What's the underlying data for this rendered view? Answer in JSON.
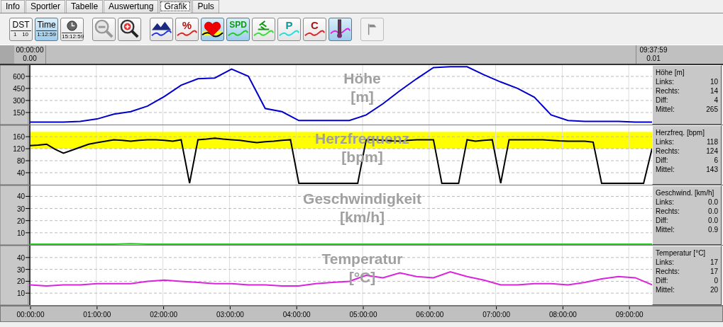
{
  "tabs": [
    {
      "label": "Info",
      "selected": false
    },
    {
      "label": "Sportler",
      "selected": false
    },
    {
      "label": "Tabelle",
      "selected": false
    },
    {
      "label": "Auswertung",
      "selected": false
    },
    {
      "label": "Grafik",
      "selected": true
    },
    {
      "label": "Puls",
      "selected": false
    }
  ],
  "toolbar": {
    "groups": [
      [
        {
          "kind": "dst",
          "label": "DST",
          "scale": [
            "1",
            "10"
          ],
          "selected": false
        },
        {
          "kind": "time",
          "label": "Time",
          "reading": "1:12:59",
          "selected": true
        },
        {
          "kind": "clock",
          "reading": "15:12:59",
          "selected": false
        }
      ],
      [
        {
          "kind": "zoom_out"
        },
        {
          "kind": "zoom_in"
        }
      ],
      [
        {
          "kind": "altitude",
          "selected": false
        },
        {
          "kind": "percent",
          "label": "%",
          "selected": false
        },
        {
          "kind": "heart",
          "selected": true
        },
        {
          "kind": "speed",
          "label": "SPD",
          "selected": true
        },
        {
          "kind": "cadence",
          "selected": false
        },
        {
          "kind": "power",
          "label": "P",
          "selected": false
        },
        {
          "kind": "calories",
          "label": "C",
          "selected": false
        },
        {
          "kind": "temperature",
          "selected": true
        }
      ],
      [
        {
          "kind": "flag",
          "disabled": true
        }
      ]
    ]
  },
  "ruler": {
    "left": {
      "time": "00:00:00",
      "value": "0.00"
    },
    "right": {
      "time": "09:37:59",
      "value": "0.01"
    }
  },
  "panels": [
    {
      "chart_data": {
        "type": "line",
        "title": "Höhe [m]",
        "categories": [
          null,
          null,
          null,
          null,
          null,
          null,
          null,
          null,
          null,
          null,
          null,
          null,
          null,
          null,
          null,
          null,
          null,
          null,
          null,
          null,
          null,
          null,
          null,
          null,
          null,
          null,
          null,
          null,
          null,
          null,
          null,
          null,
          null,
          null,
          null,
          null,
          null,
          null
        ],
        "ylim": [
          0,
          740
        ],
        "yticks": [
          150,
          300,
          450,
          600
        ],
        "grid": true,
        "series": [
          {
            "color": "#0000cc",
            "values": [
              30,
              30,
              30,
              40,
              70,
              130,
              160,
              230,
              350,
              490,
              570,
              580,
              690,
              600,
              200,
              160,
              50,
              50,
              50,
              50,
              120,
              260,
              420,
              570,
              710,
              720,
              720,
              620,
              530,
              450,
              340,
              120,
              50,
              40,
              40,
              40,
              30,
              30
            ]
          }
        ]
      },
      "info": {
        "heading": "Höhe [m]",
        "rows": [
          {
            "label": "Links:",
            "value": "10"
          },
          {
            "label": "Rechts:",
            "value": "14"
          },
          {
            "label": "Diff:",
            "value": "4"
          },
          {
            "label": "Mittel:",
            "value": "265"
          }
        ]
      }
    },
    {
      "chart_data": {
        "type": "line",
        "title": "Herzfrequenz [bpm]",
        "categories": [
          null,
          null,
          null,
          null,
          null,
          null,
          null,
          null,
          null,
          null,
          null,
          null,
          null,
          null,
          null,
          null,
          null,
          null,
          null,
          null,
          null,
          null,
          null,
          null,
          null,
          null,
          null,
          null,
          null,
          null,
          null,
          null,
          null,
          null,
          null,
          null,
          null,
          null,
          null,
          null,
          null,
          null,
          null,
          null,
          null,
          null,
          null,
          null,
          null,
          null,
          null,
          null,
          null,
          null,
          null,
          null,
          null,
          null,
          null,
          null,
          null,
          null,
          null,
          null,
          null,
          null,
          null,
          null,
          null,
          null,
          null,
          null,
          null,
          null,
          null
        ],
        "ylim": [
          0,
          198
        ],
        "yticks": [
          40,
          80,
          120,
          160
        ],
        "series": [
          {
            "color": "#000000",
            "values": [
              130,
              132,
              135,
              118,
              105,
              115,
              125,
              135,
              140,
              145,
              150,
              148,
              145,
              148,
              150,
              150,
              148,
              145,
              150,
              5,
              150,
              152,
              155,
              152,
              150,
              148,
              144,
              140,
              143,
              145,
              148,
              150,
              5,
              5,
              5,
              5,
              5,
              5,
              5,
              5,
              150,
              150,
              148,
              146,
              145,
              148,
              150,
              150,
              150,
              5,
              5,
              5,
              150,
              145,
              148,
              150,
              5,
              150,
              150,
              150,
              150,
              150,
              148,
              146,
              145,
              145,
              145,
              142,
              5,
              5,
              5,
              5,
              5,
              5,
              120
            ]
          }
        ],
        "grid": true,
        "bands": [
          {
            "axis": "y",
            "from": 120,
            "to": 176
          }
        ]
      },
      "info": {
        "heading": "Herzfreq. [bpm]",
        "rows": [
          {
            "label": "Links:",
            "value": "118"
          },
          {
            "label": "Rechts:",
            "value": "124"
          },
          {
            "label": "Diff:",
            "value": "6"
          },
          {
            "label": "Mittel:",
            "value": "143"
          }
        ]
      }
    },
    {
      "chart_data": {
        "type": "line",
        "title": "Geschwindigkeit [km/h]",
        "categories": [
          null,
          null,
          null,
          null,
          null,
          null,
          null,
          null,
          null,
          null,
          null,
          null,
          null,
          null,
          null,
          null,
          null,
          null,
          null,
          null,
          null,
          null,
          null,
          null,
          null,
          null,
          null,
          null,
          null,
          null,
          null,
          null,
          null,
          null,
          null,
          null,
          null,
          null
        ],
        "ylim": [
          0,
          49
        ],
        "yticks": [
          10,
          20,
          30,
          40
        ],
        "grid": true,
        "series": [
          {
            "color": "#22cc22",
            "values": [
              0,
              0,
              0,
              0,
              0,
              0,
              1,
              0,
              0,
              0,
              0,
              0,
              0,
              0,
              0,
              0,
              0,
              0,
              0,
              0,
              0,
              0,
              0,
              0,
              0,
              0,
              0,
              0,
              0,
              0,
              0,
              0,
              0,
              0,
              0,
              0,
              0,
              0
            ]
          }
        ]
      },
      "info": {
        "heading": "Geschwind. [km/h]",
        "rows": [
          {
            "label": "Links:",
            "value": "0.0"
          },
          {
            "label": "Rechts:",
            "value": "0.0"
          },
          {
            "label": "Diff:",
            "value": "0.0"
          },
          {
            "label": "Mittel:",
            "value": "0.9"
          }
        ]
      }
    },
    {
      "chart_data": {
        "type": "line",
        "title": "Temperatur [°C]",
        "categories": [
          null,
          null,
          null,
          null,
          null,
          null,
          null,
          null,
          null,
          null,
          null,
          null,
          null,
          null,
          null,
          null,
          null,
          null,
          null,
          null,
          null,
          null,
          null,
          null,
          null,
          null,
          null,
          null,
          null,
          null,
          null,
          null,
          null,
          null,
          null,
          null,
          null,
          null
        ],
        "ylim": [
          0,
          50
        ],
        "yticks": [
          10,
          20,
          30,
          40
        ],
        "grid": true,
        "series": [
          {
            "color": "#dd22dd",
            "values": [
              17,
              16,
              17,
              17,
              18,
              18,
              18,
              20,
              21,
              20,
              19,
              18,
              18,
              17,
              17,
              16,
              16,
              18,
              19,
              20,
              25,
              23,
              27,
              24,
              23,
              28,
              24,
              21,
              17,
              17,
              18,
              18,
              17,
              19,
              22,
              24,
              23,
              17
            ]
          }
        ]
      },
      "info": {
        "heading": "Temperatur [°C]",
        "rows": [
          {
            "label": "Links:",
            "value": "17"
          },
          {
            "label": "Rechts:",
            "value": "17"
          },
          {
            "label": "Diff:",
            "value": "0"
          },
          {
            "label": "Mittel:",
            "value": "20"
          }
        ]
      }
    }
  ],
  "time_axis": [
    "00:00:00",
    "01:00:00",
    "02:00:00",
    "03:00:00",
    "04:00:00",
    "05:00:00",
    "06:00:00",
    "07:00:00",
    "08:00:00",
    "09:00:00"
  ]
}
